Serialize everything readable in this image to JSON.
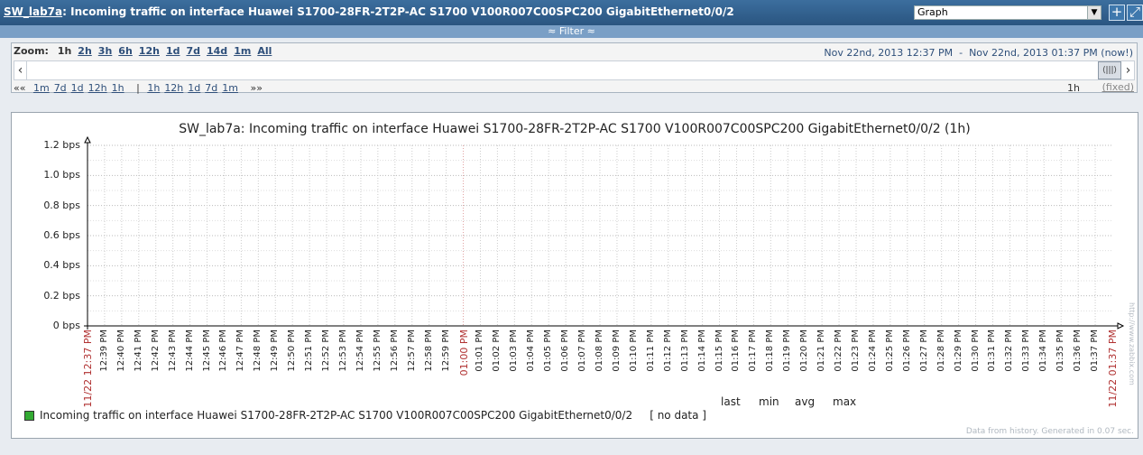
{
  "header": {
    "host": "SW_lab7a",
    "title_rest": ": Incoming traffic on interface Huawei S1700-28FR-2T2P-AC S1700 V100R007C00SPC200 GigabitEthernet0/0/2",
    "view_select": "Graph",
    "add_icon": "plus-icon",
    "fullscreen_icon": "fullscreen-icon"
  },
  "filter": {
    "label": "≈ Filter ≈"
  },
  "zoom": {
    "label": "Zoom:",
    "options": [
      "1h",
      "2h",
      "3h",
      "6h",
      "12h",
      "1d",
      "7d",
      "14d",
      "1m",
      "All"
    ],
    "current": "1h",
    "period_start": "Nov 22nd, 2013 12:37 PM",
    "period_sep": "-",
    "period_end": "Nov 22nd, 2013 01:37 PM (now!)",
    "nav_back_mark": "««",
    "nav_back": [
      "1m",
      "7d",
      "1d",
      "12h",
      "1h"
    ],
    "nav_sep": "|",
    "nav_fwd": [
      "1h",
      "12h",
      "1d",
      "7d",
      "1m"
    ],
    "nav_fwd_mark": "»»",
    "duration": "1h",
    "fixed": "(fixed)"
  },
  "graph": {
    "title": "SW_lab7a: Incoming traffic on interface Huawei S1700-28FR-2T2P-AC S1700 V100R007C00SPC200 GigabitEthernet0/0/2 (1h)",
    "legend_headers": [
      "last",
      "min",
      "avg",
      "max"
    ],
    "legend_item": "Incoming traffic on interface Huawei S1700-28FR-2T2P-AC S1700 V100R007C00SPC200 GigabitEthernet0/0/2",
    "legend_value": "[ no data ]",
    "footer": "Data from history. Generated in 0.07 sec.",
    "watermark": "http://www.zabbix.com"
  },
  "chart_data": {
    "type": "line",
    "title": "SW_lab7a: Incoming traffic on interface Huawei S1700-28FR-2T2P-AC S1700 V100R007C00SPC200 GigabitEthernet0/0/2 (1h)",
    "ylim": [
      0,
      1.2
    ],
    "y_ticks": [
      "0 bps",
      "0.2 bps",
      "0.4 bps",
      "0.6 bps",
      "0.8 bps",
      "1.0 bps",
      "1.2 bps"
    ],
    "x_ticks": [
      "11/22 12:37 PM",
      "12:39 PM",
      "12:40 PM",
      "12:41 PM",
      "12:42 PM",
      "12:43 PM",
      "12:44 PM",
      "12:45 PM",
      "12:46 PM",
      "12:47 PM",
      "12:48 PM",
      "12:49 PM",
      "12:50 PM",
      "12:51 PM",
      "12:52 PM",
      "12:53 PM",
      "12:54 PM",
      "12:55 PM",
      "12:56 PM",
      "12:57 PM",
      "12:58 PM",
      "12:59 PM",
      "01:00 PM",
      "01:01 PM",
      "01:02 PM",
      "01:03 PM",
      "01:04 PM",
      "01:05 PM",
      "01:06 PM",
      "01:07 PM",
      "01:08 PM",
      "01:09 PM",
      "01:10 PM",
      "01:11 PM",
      "01:12 PM",
      "01:13 PM",
      "01:14 PM",
      "01:15 PM",
      "01:16 PM",
      "01:17 PM",
      "01:18 PM",
      "01:19 PM",
      "01:20 PM",
      "01:21 PM",
      "01:22 PM",
      "01:23 PM",
      "01:24 PM",
      "01:25 PM",
      "01:26 PM",
      "01:27 PM",
      "01:28 PM",
      "01:29 PM",
      "01:30 PM",
      "01:31 PM",
      "01:32 PM",
      "01:33 PM",
      "01:34 PM",
      "01:35 PM",
      "01:36 PM",
      "01:37 PM",
      "11/22 01:37 PM"
    ],
    "highlight_ticks": [
      "11/22 12:37 PM",
      "01:00 PM",
      "11/22 01:37 PM"
    ],
    "series": [
      {
        "name": "Incoming traffic on interface Huawei S1700-28FR-2T2P-AC S1700 V100R007C00SPC200 GigabitEthernet0/0/2",
        "color": "#33aa33",
        "values": []
      }
    ],
    "grid": true
  }
}
